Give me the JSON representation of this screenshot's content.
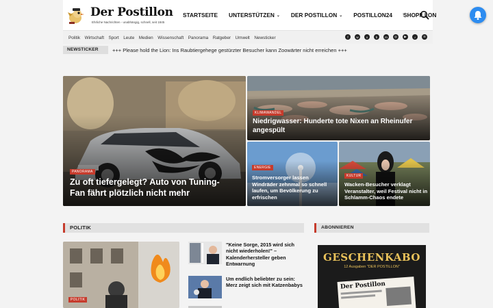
{
  "brand": {
    "name": "Der Postillon",
    "slogan": "Ehrliche Nachrichten - unabhängig, schnell, seit 1845"
  },
  "nav": {
    "items": [
      {
        "label": "STARTSEITE",
        "dropdown": false
      },
      {
        "label": "UNTERSTÜTZEN",
        "dropdown": true
      },
      {
        "label": "DER POSTILLON",
        "dropdown": true
      },
      {
        "label": "POSTILLON24",
        "dropdown": false
      },
      {
        "label": "SHOPILLON",
        "dropdown": false
      }
    ]
  },
  "icons": {
    "search": "search-icon",
    "theme": "theme-toggle-icon",
    "notification": "bell-icon",
    "social": [
      "facebook-icon",
      "whatsapp-icon",
      "x-icon",
      "bluesky-icon",
      "mastodon-icon",
      "instagram-icon",
      "youtube-icon",
      "tiktok-icon",
      "rss-icon"
    ]
  },
  "subnav": {
    "items": [
      "Politik",
      "Wirtschaft",
      "Sport",
      "Leute",
      "Medien",
      "Wissenschaft",
      "Panorama",
      "Ratgeber",
      "Umwelt",
      "Newsticker"
    ]
  },
  "ticker": {
    "label": "NEWSTICKER",
    "text": "+++ Please hold the Lion: Ins Raubtiergehege gestürzter Besucher kann Zoowärter nicht erreichen +++"
  },
  "hero": {
    "main": {
      "tag": "PANORAMA",
      "title": "Zu oft tiefergelegt? Auto von Tuning-Fan fährt plötzlich nicht mehr"
    },
    "top_right": {
      "tag": "KLIMAWANDEL",
      "title": "Niedrigwasser: Hunderte tote Nixen an Rheinufer angespült"
    },
    "bottom_left": {
      "tag": "ENERGIE",
      "title": "Stromversorger lassen Windräder zehnmal so schnell laufen, um Bevölkerung zu erfrischen"
    },
    "bottom_right": {
      "tag": "KULTUR",
      "title": "Wacken-Besucher verklagt Veranstalter, weil Festival nicht in Schlamm-Chaos endete"
    }
  },
  "politik": {
    "heading": "POLITIK",
    "lead_tag": "POLITIK",
    "side": [
      "\"Keine Sorge, 2015 wird sich nicht wiederholen!\" – Kalenderhersteller geben Entwarnung",
      "Um endlich beliebter zu sein: Merz zeigt sich mit Katzenbabys"
    ]
  },
  "sidebar": {
    "heading": "ABONNIEREN",
    "promo_title": "GESCHENKABO",
    "promo_sub": "12 Ausgaben \"DER POSTILLON\""
  },
  "colors": {
    "accent": "#c63b2c",
    "notification": "#2d8cf0",
    "promo_gold": "#d4a23c"
  }
}
